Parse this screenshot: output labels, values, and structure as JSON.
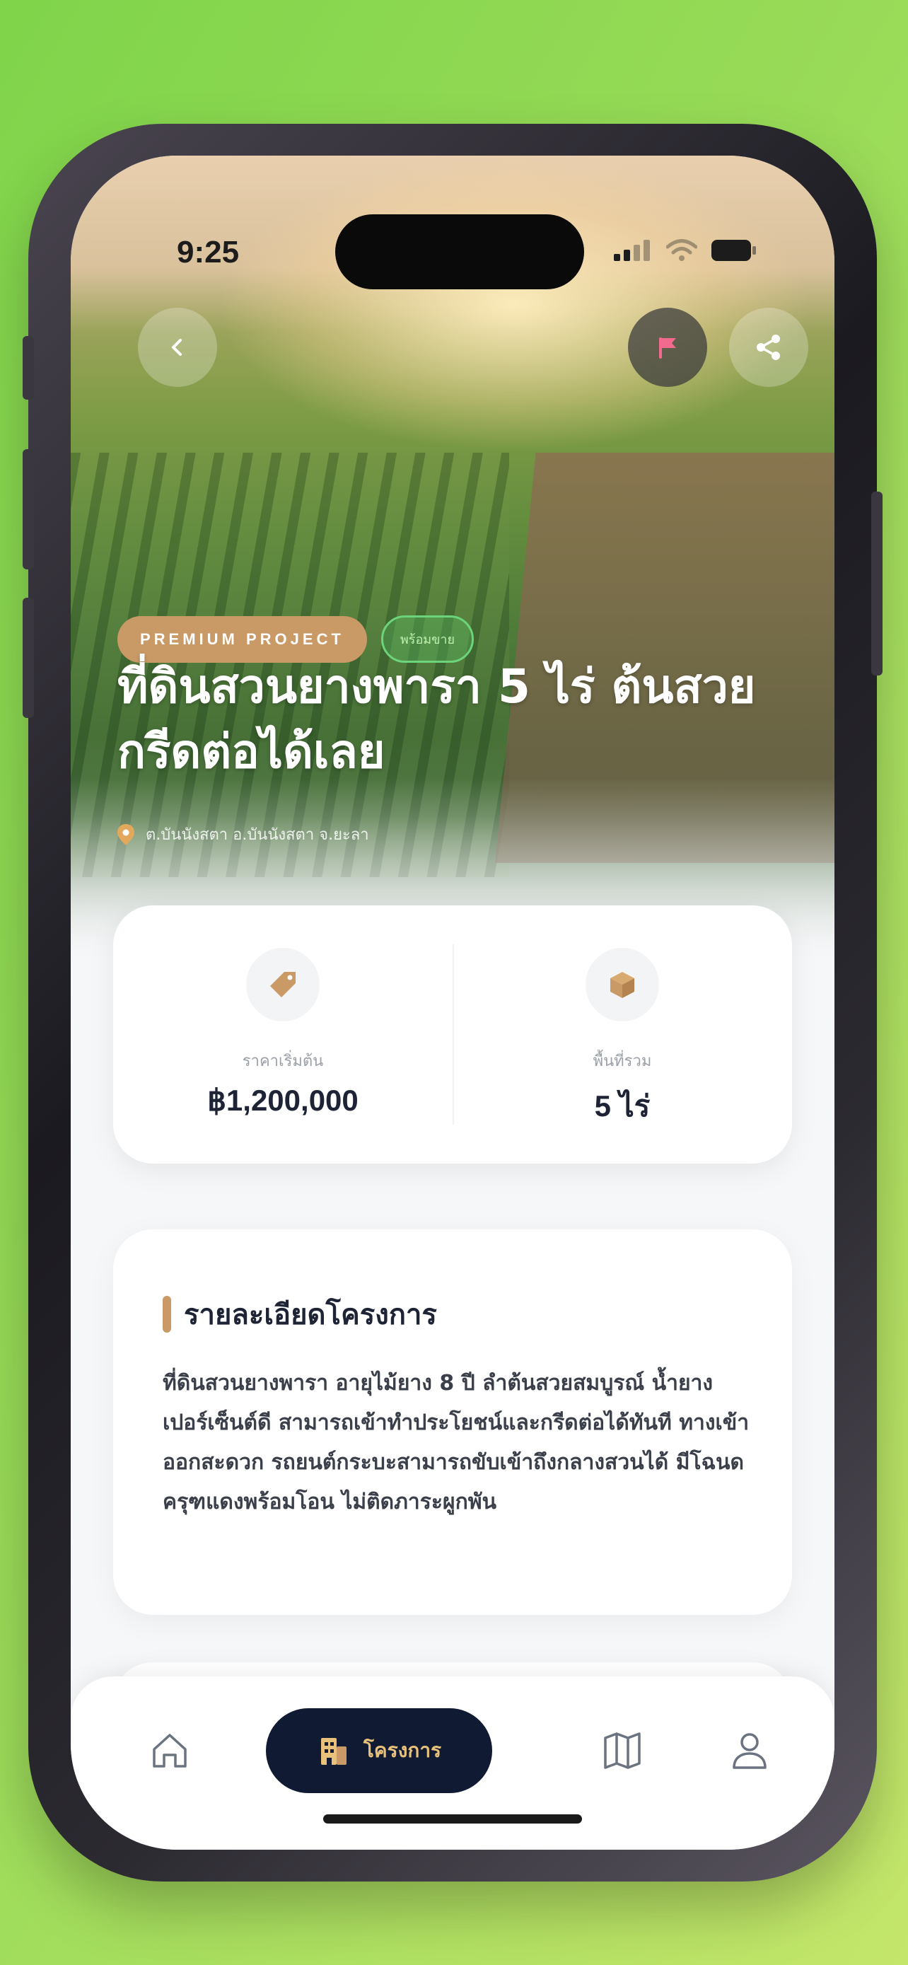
{
  "status_bar": {
    "time": "9:25"
  },
  "header": {
    "back_icon": "chevron-left-icon",
    "flag_icon": "flag-icon",
    "share_icon": "share-icon"
  },
  "badges": {
    "premium": "PREMIUM PROJECT",
    "status": "พร้อมขาย"
  },
  "project": {
    "title": "ที่ดินสวนยางพารา 5 ไร่ ต้นสวย กรีดต่อได้เลย",
    "location": "ต.บันนังสตา อ.บันนังสตา จ.ยะลา"
  },
  "stats": {
    "price_label": "ราคาเริ่มต้น",
    "price_value": "฿1,200,000",
    "area_label": "พื้นที่รวม",
    "area_value": "5 ไร่"
  },
  "details": {
    "heading": "รายละเอียดโครงการ",
    "body": "ที่ดินสวนยางพารา อายุไม้ยาง 8 ปี ลำต้นสวยสมบูรณ์ น้ำยางเปอร์เซ็นต์ดี สามารถเข้าทำประโยชน์และกรีดต่อได้ทันที ทางเข้าออกสะดวก รถยนต์กระบะสามารถขับเข้าถึงกลางสวนได้ มีโฉนดครุฑแดงพร้อมโอน ไม่ติดภาระผูกพัน"
  },
  "tabbar": {
    "active_label": "โครงการ"
  },
  "colors": {
    "accent": "#c99a66",
    "nav_dark": "#111a33",
    "nav_active_text": "#e8c27a",
    "flag": "#f26a8d"
  }
}
